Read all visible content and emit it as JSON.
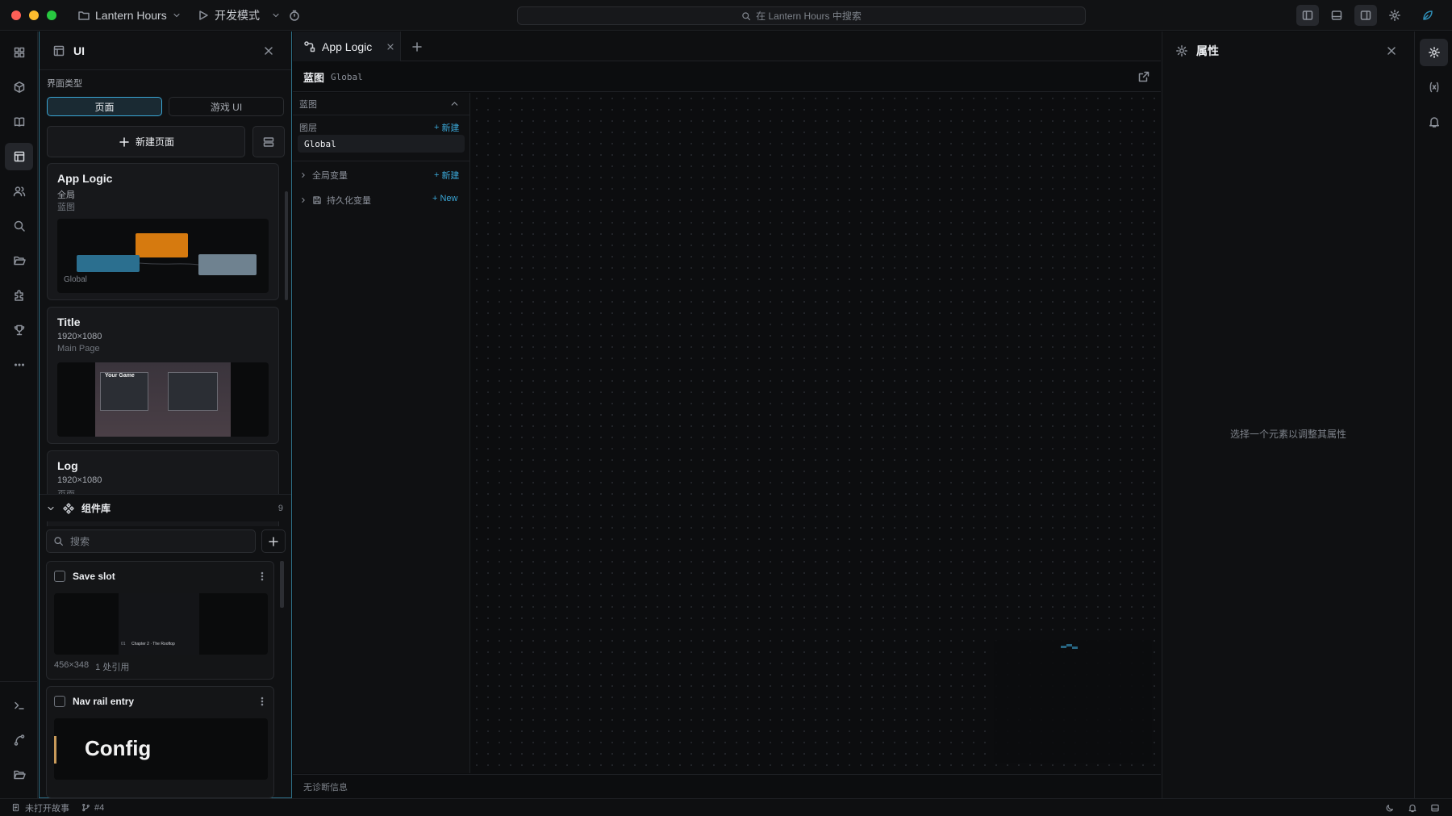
{
  "titlebar": {
    "project_name": "Lantern Hours",
    "mode_label": "开发模式",
    "search_placeholder": "在 Lantern Hours 中搜索"
  },
  "ui_panel": {
    "title": "UI",
    "interface_type_label": "界面类型",
    "seg_page": "页面",
    "seg_game_ui": "游戏 UI",
    "new_page_label": "新建页面",
    "pages": [
      {
        "title": "App Logic",
        "sub1": "全局",
        "sub2": "蓝图",
        "thumb_label": "Global"
      },
      {
        "title": "Title",
        "sub1": "1920×1080",
        "sub2": "Main Page",
        "thumb_label": "Your Game"
      },
      {
        "title": "Log",
        "sub1": "1920×1080",
        "sub2": "页面"
      }
    ],
    "library": {
      "title": "组件库",
      "count": "9",
      "search_placeholder": "搜索",
      "components": [
        {
          "name": "Save slot",
          "preview_text": "Chapter 2 · The Rooftop",
          "preview_num": "01",
          "meta_size": "456×348",
          "meta_refs": "1 处引用"
        },
        {
          "name": "Nav rail entry",
          "preview_text": "Config"
        }
      ]
    }
  },
  "editor": {
    "tab_label": "App Logic",
    "crumb_title": "蓝图",
    "crumb_scope": "Global",
    "blueprint_section": "蓝图",
    "layers_label": "图层",
    "new_label": "新建",
    "layer_item": "Global",
    "global_vars_label": "全局变量",
    "persistent_vars_label": "持久化变量",
    "new_en_label": "New",
    "diagnostics": "无诊断信息"
  },
  "properties": {
    "title": "属性",
    "empty_hint": "选择一个元素以调整其属性"
  },
  "statusbar": {
    "story_status": "未打开故事",
    "branch": "#4"
  },
  "colors": {
    "accent": "#3aa6d6",
    "panel_border": "#2e6f86",
    "orange_node": "#d67a0f",
    "blue_node": "#2b6f8f",
    "grey_node": "#6f8290"
  }
}
